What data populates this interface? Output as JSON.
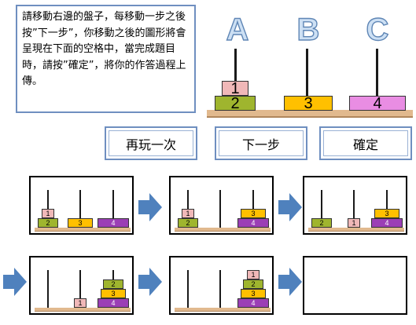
{
  "instructions": "請移動右邊的盤子，每移動一步之後按”下一步”，你移動之後的圖形將會呈現在下面的空格中，當完成題目時，請按”確定”，將你的作答過程上傳。",
  "pegs": [
    "A",
    "B",
    "C"
  ],
  "main_disks": [
    {
      "label": "1",
      "color": "#f0b8b8"
    },
    {
      "label": "2",
      "color": "#9fb52e"
    },
    {
      "label": "3",
      "color": "#ffc000"
    },
    {
      "label": "4",
      "color": "#e98de3"
    }
  ],
  "buttons": {
    "replay": "再玩一次",
    "next": "下一步",
    "confirm": "確定"
  },
  "steps": [
    {
      "step": 1,
      "disks": {
        "peg1": [
          "2",
          "1"
        ],
        "peg2": [
          "3"
        ],
        "peg3": [
          "4"
        ]
      }
    },
    {
      "step": 2,
      "disks": {
        "peg1": [
          "2",
          "1"
        ],
        "peg2": [],
        "peg3": [
          "4",
          "3"
        ]
      }
    },
    {
      "step": 3,
      "disks": {
        "peg1": [
          "2"
        ],
        "peg2": [
          "1"
        ],
        "peg3": [
          "4",
          "3"
        ]
      }
    },
    {
      "step": 4,
      "disks": {
        "peg1": [],
        "peg2": [
          "1"
        ],
        "peg3": [
          "4",
          "3",
          "2"
        ]
      }
    },
    {
      "step": 5,
      "disks": {
        "peg1": [],
        "peg2": [],
        "peg3": [
          "4",
          "3",
          "2",
          "1"
        ]
      }
    },
    {
      "step": 6,
      "disks": null
    }
  ],
  "disk_colors": {
    "1": "#f0b8b8",
    "2": "#9fb52e",
    "3": "#ffc000",
    "4": "#9b3fb5"
  }
}
